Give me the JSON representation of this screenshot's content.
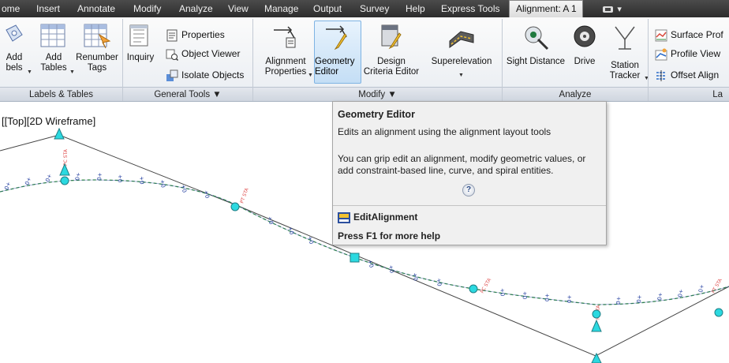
{
  "tabs": [
    {
      "label": "ome"
    },
    {
      "label": "Insert"
    },
    {
      "label": "Annotate"
    },
    {
      "label": "Modify"
    },
    {
      "label": "Analyze"
    },
    {
      "label": "View"
    },
    {
      "label": "Manage"
    },
    {
      "label": "Output"
    },
    {
      "label": "Survey"
    },
    {
      "label": "Help"
    },
    {
      "label": "Express Tools"
    },
    {
      "label": "Alignment: A 1"
    }
  ],
  "tab_extra": "▾",
  "ribbon": {
    "labels_tables": {
      "add_labels": [
        "Add",
        "bels"
      ],
      "add_tables": [
        "Add",
        "Tables"
      ],
      "renumber_tags": [
        "Renumber",
        "Tags"
      ],
      "footer": "Labels & Tables"
    },
    "general_tools": {
      "inquiry": "Inquiry",
      "properties": "Properties",
      "object_viewer": "Object Viewer",
      "isolate_objects": "Isolate Objects",
      "footer": "General Tools ▼"
    },
    "modify": {
      "alignment_properties": [
        "Alignment",
        "Properties"
      ],
      "geometry_editor": [
        "Geometry",
        "Editor"
      ],
      "design_criteria_editor": [
        "Design",
        "Criteria Editor"
      ],
      "superelevation": "Superelevation",
      "footer": "Modify ▼"
    },
    "analyze": {
      "sight_distance": "Sight Distance",
      "drive": "Drive",
      "station_tracker": [
        "Station",
        "Tracker"
      ],
      "footer": "Analyze"
    },
    "launch_pad": {
      "surface_profile": "Surface Prof",
      "profile_view": "Profile View",
      "offset_alignment": "Offset Align",
      "footer": "La"
    }
  },
  "viewport_label": "[[Top][2D Wireframe]",
  "tooltip": {
    "title": "Geometry Editor",
    "description": "Edits an alignment using the alignment layout tools",
    "extended": "You can grip edit an alignment, modify geometric values, or add constraint-based line, curve, and spiral entities.",
    "help_glyph": "?",
    "command": "EditAlignment",
    "f1_help": "Press F1 for more help"
  },
  "colors": {
    "alignment_line": "#3a9a3a",
    "tangent_line": "#444444",
    "grip_cyan": "#2bd9e0",
    "station_label_blue": "#1e3a9e",
    "pi_label_red": "#e05050"
  }
}
